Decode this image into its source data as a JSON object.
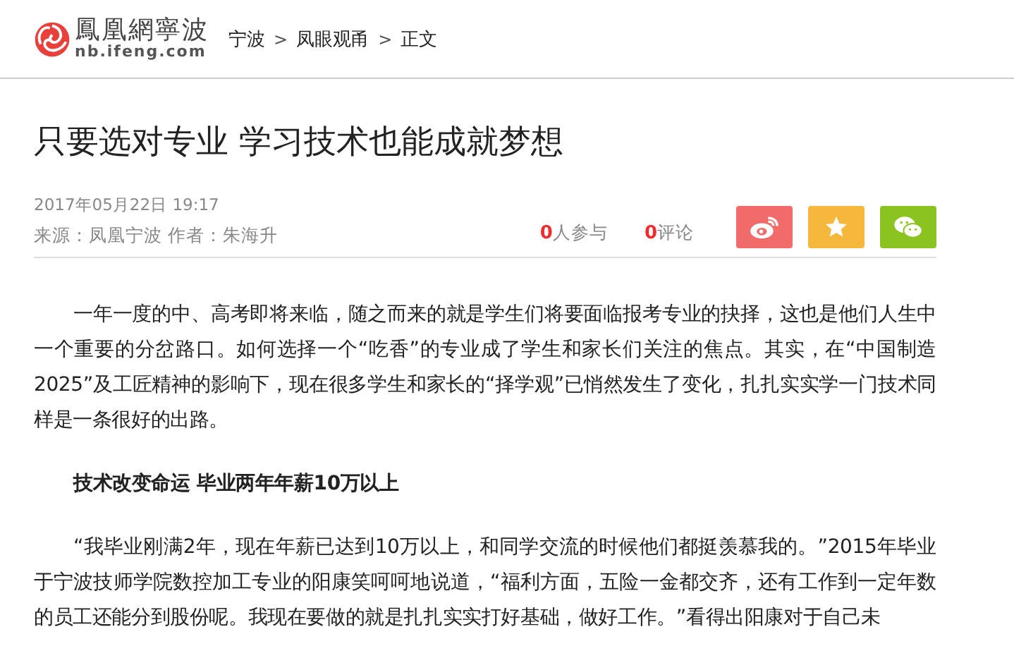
{
  "header": {
    "logo": {
      "name": "鳳凰網寧波",
      "domain": "nb.ifeng.com"
    },
    "breadcrumb": [
      {
        "label": "宁波"
      },
      {
        "label": "凤眼观甬"
      },
      {
        "label": "正文"
      }
    ],
    "separator": ">"
  },
  "article": {
    "title": "只要选对专业 学习技术也能成就梦想",
    "date": "2017年05月22日  19:17",
    "source": "来源：凤凰宁波  作者：朱海升",
    "stats": [
      {
        "count": "0",
        "label": "人参与"
      },
      {
        "count": "0",
        "label": "评论"
      }
    ],
    "share_buttons": [
      {
        "kind": "weibo",
        "color": "#f26b6b"
      },
      {
        "kind": "favorite",
        "color": "#f5b83d"
      },
      {
        "kind": "wechat",
        "color": "#8bc421"
      }
    ],
    "body": [
      {
        "kind": "paragraph",
        "text": "一年一度的中、高考即将来临，随之而来的就是学生们将要面临报考专业的抉择，这也是他们人生中一个重要的分岔路口。如何选择一个“吃香”的专业成了学生和家长们关注的焦点。其实，在“中国制造2025”及工匠精神的影响下，现在很多学生和家长的“择学观”已悄然发生了变化，扎扎实实学一门技术同样是一条很好的出路。"
      },
      {
        "kind": "heading",
        "text": "技术改变命运 毕业两年年薪10万以上"
      },
      {
        "kind": "paragraph",
        "text": "“我毕业刚满2年，现在年薪已达到10万以上，和同学交流的时候他们都挺羡慕我的。”2015年毕业于宁波技师学院数控加工专业的阳康笑呵呵地说道，“福利方面，五险一金都交齐，还有工作到一定年数的员工还能分到股份呢。我现在要做的就是扎扎实实打好基础，做好工作。”看得出阳康对于自己未"
      }
    ]
  }
}
